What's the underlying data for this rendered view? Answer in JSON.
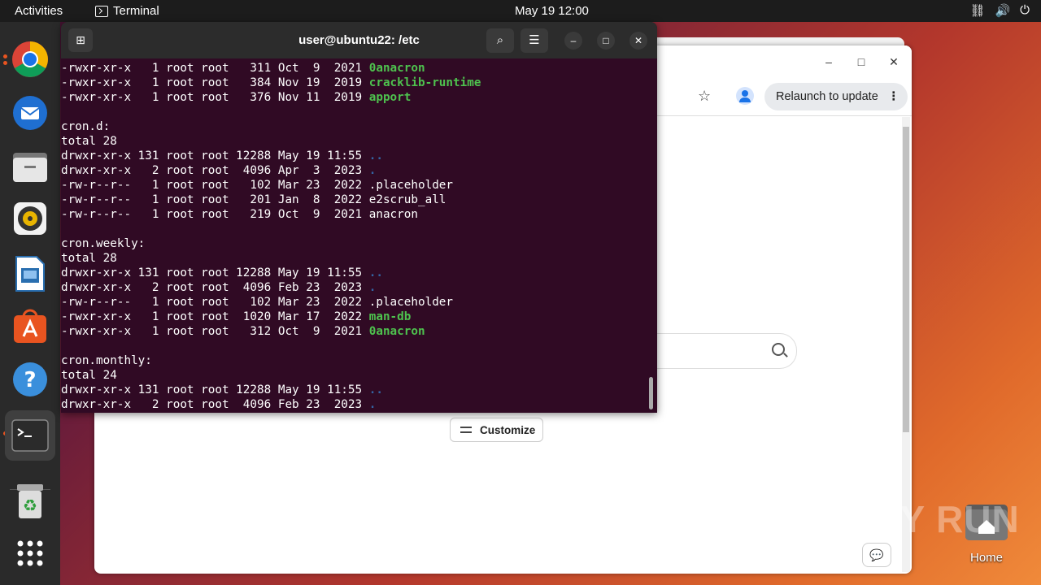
{
  "topbar": {
    "activities": "Activities",
    "app_name": "Terminal",
    "clock": "May 19  12:00"
  },
  "dock": {
    "items": [
      "Google Chrome",
      "Thunderbird",
      "Files",
      "Rhythmbox",
      "LibreOffice Impress",
      "Ubuntu Software",
      "Help",
      "Terminal",
      "Trash",
      "Show Applications"
    ]
  },
  "chrome": {
    "relaunch_label": "Relaunch to update",
    "customize_label": "Customize"
  },
  "terminal": {
    "title": "user@ubuntu22: /etc",
    "lines": [
      {
        "text": "-rwxr-xr-x   1 root root   311 Oct  9  2021 ",
        "name": "0anacron",
        "style": "g"
      },
      {
        "text": "-rwxr-xr-x   1 root root   384 Nov 19  2019 ",
        "name": "cracklib-runtime",
        "style": "g"
      },
      {
        "text": "-rwxr-xr-x   1 root root   376 Nov 11  2019 ",
        "name": "apport",
        "style": "g"
      },
      {
        "text": "",
        "name": "",
        "style": ""
      },
      {
        "text": "cron.d:",
        "name": "",
        "style": ""
      },
      {
        "text": "total 28",
        "name": "",
        "style": ""
      },
      {
        "text": "drwxr-xr-x 131 root root 12288 May 19 11:55 ",
        "name": "..",
        "style": "b"
      },
      {
        "text": "drwxr-xr-x   2 root root  4096 Apr  3  2023 ",
        "name": ".",
        "style": "b"
      },
      {
        "text": "-rw-r--r--   1 root root   102 Mar 23  2022 ",
        "name": ".placeholder",
        "style": ""
      },
      {
        "text": "-rw-r--r--   1 root root   201 Jan  8  2022 ",
        "name": "e2scrub_all",
        "style": ""
      },
      {
        "text": "-rw-r--r--   1 root root   219 Oct  9  2021 ",
        "name": "anacron",
        "style": ""
      },
      {
        "text": "",
        "name": "",
        "style": ""
      },
      {
        "text": "cron.weekly:",
        "name": "",
        "style": ""
      },
      {
        "text": "total 28",
        "name": "",
        "style": ""
      },
      {
        "text": "drwxr-xr-x 131 root root 12288 May 19 11:55 ",
        "name": "..",
        "style": "b"
      },
      {
        "text": "drwxr-xr-x   2 root root  4096 Feb 23  2023 ",
        "name": ".",
        "style": "b"
      },
      {
        "text": "-rw-r--r--   1 root root   102 Mar 23  2022 ",
        "name": ".placeholder",
        "style": ""
      },
      {
        "text": "-rwxr-xr-x   1 root root  1020 Mar 17  2022 ",
        "name": "man-db",
        "style": "g"
      },
      {
        "text": "-rwxr-xr-x   1 root root   312 Oct  9  2021 ",
        "name": "0anacron",
        "style": "g"
      },
      {
        "text": "",
        "name": "",
        "style": ""
      },
      {
        "text": "cron.monthly:",
        "name": "",
        "style": ""
      },
      {
        "text": "total 24",
        "name": "",
        "style": ""
      },
      {
        "text": "drwxr-xr-x 131 root root 12288 May 19 11:55 ",
        "name": "..",
        "style": "b"
      },
      {
        "text": "drwxr-xr-x   2 root root  4096 Feb 23  2023 ",
        "name": ".",
        "style": "b"
      }
    ]
  },
  "desktop": {
    "home_label": "Home"
  },
  "watermark": "ANY RUN",
  "colors": {
    "terminal_bg": "#300a24",
    "exec_green": "#4ec24e",
    "dir_blue": "#3465a4",
    "ubuntu_orange": "#e95420"
  }
}
